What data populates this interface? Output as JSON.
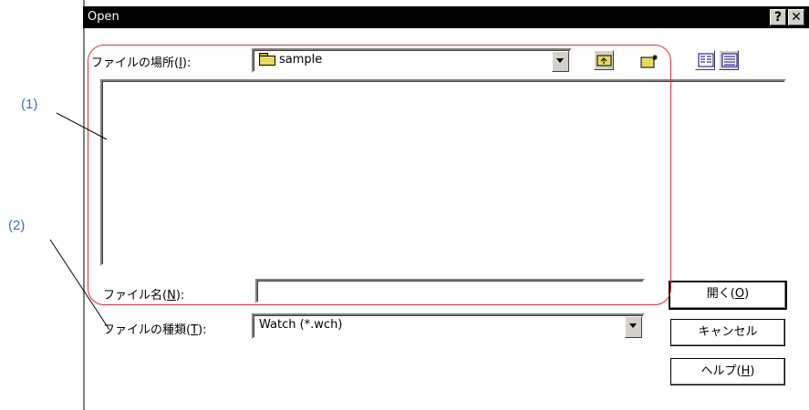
{
  "window": {
    "title": "Open"
  },
  "title_buttons": {
    "help": "?",
    "close": "✕"
  },
  "look_in": {
    "label": "ファイルの場所(",
    "accel": "I",
    "label_end": "):",
    "value": "sample"
  },
  "toolbar": {
    "icons": [
      "up-folder-icon",
      "new-folder-icon",
      "list-view-icon",
      "details-view-icon"
    ]
  },
  "file_name": {
    "label": "ファイル名(",
    "accel": "N",
    "label_end": "):",
    "value": ""
  },
  "file_type": {
    "label": "ファイルの種類(",
    "accel": "T",
    "label_end": "):",
    "value": "Watch (*.wch)"
  },
  "buttons": {
    "open": {
      "label": "開く(",
      "accel": "O",
      "label_end": ")"
    },
    "cancel": {
      "label": "キャンセル"
    },
    "help": {
      "label": "ヘルプ(",
      "accel": "H",
      "label_end": ")"
    }
  },
  "annotations": {
    "one": "(1)",
    "two": "(2)"
  },
  "colors": {
    "titlebar": "#000000",
    "annotation": "#3a6ac8",
    "highlight_box": "#e0303a",
    "face": "#d4d0c8"
  }
}
